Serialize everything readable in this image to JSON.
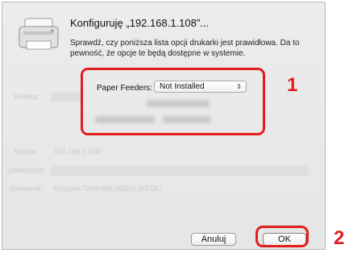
{
  "dialog": {
    "title": "Konfiguruję „192.168.1.108”...",
    "message": "Sprawdź, czy poniższa lista opcji drukarki jest prawidłowa. Da to pewność, że opcje te będą dostępne w systemie.",
    "options": [
      {
        "label": "Paper Feeders:",
        "value": "Not Installed"
      }
    ],
    "cancel_label": "Anuluj",
    "ok_label": "OK"
  },
  "background_form": {
    "labels": [
      "Kolejka:",
      "Nazwa:",
      "Lokalizacja:",
      "Sterownik:"
    ],
    "name_value": "192.168.1.108",
    "driver_value": "Kyocera TASKalfa 2550ci (KPDL)"
  },
  "annotations": [
    "1",
    "2"
  ],
  "colors": {
    "highlight": "#e21d1d",
    "dialog_bg": "#ececec"
  }
}
